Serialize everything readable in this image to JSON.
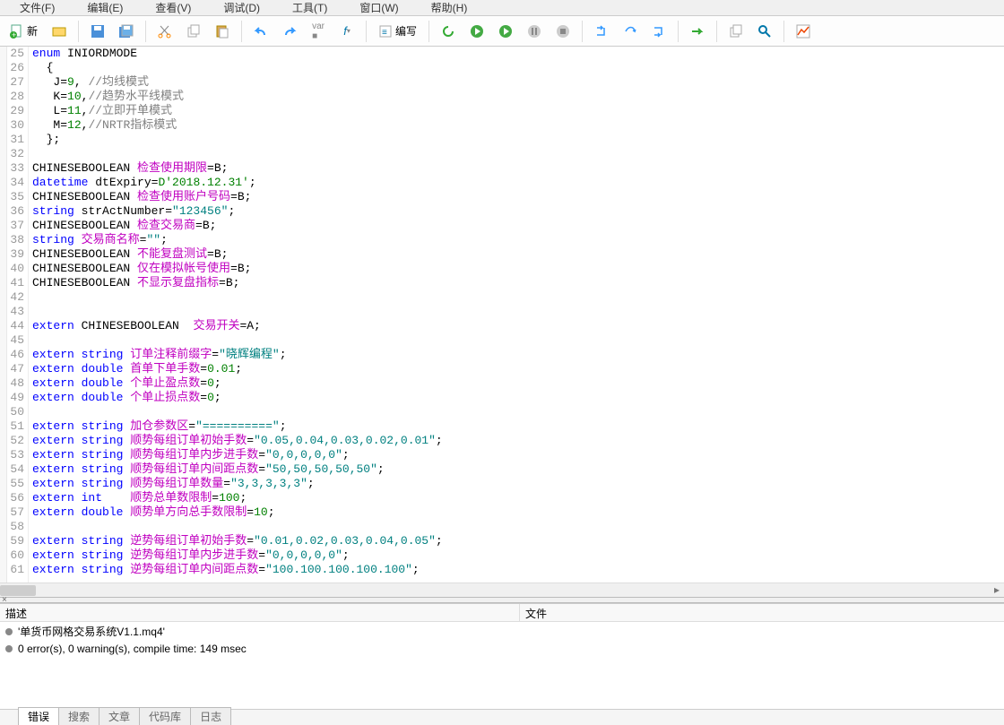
{
  "menubar": [
    {
      "label": "文件(F)"
    },
    {
      "label": "编辑(E)"
    },
    {
      "label": "查看(V)"
    },
    {
      "label": "调试(D)"
    },
    {
      "label": "工具(T)"
    },
    {
      "label": "窗口(W)"
    },
    {
      "label": "帮助(H)"
    }
  ],
  "toolbar": {
    "new_label": "新",
    "compile_label": "编写"
  },
  "code_lines": [
    {
      "n": 25,
      "tokens": [
        {
          "t": "enum",
          "c": "kw"
        },
        {
          "t": " INIORDMODE"
        }
      ]
    },
    {
      "n": 26,
      "tokens": [
        {
          "t": "  {"
        }
      ]
    },
    {
      "n": 27,
      "tokens": [
        {
          "t": "   J="
        },
        {
          "t": "9",
          "c": "num"
        },
        {
          "t": ", "
        },
        {
          "t": "//均线模式",
          "c": "com"
        }
      ]
    },
    {
      "n": 28,
      "tokens": [
        {
          "t": "   K="
        },
        {
          "t": "10",
          "c": "num"
        },
        {
          "t": ","
        },
        {
          "t": "//趋势水平线模式",
          "c": "com"
        }
      ]
    },
    {
      "n": 29,
      "tokens": [
        {
          "t": "   L="
        },
        {
          "t": "11",
          "c": "num"
        },
        {
          "t": ","
        },
        {
          "t": "//立即开单模式",
          "c": "com"
        }
      ]
    },
    {
      "n": 30,
      "tokens": [
        {
          "t": "   M="
        },
        {
          "t": "12",
          "c": "num"
        },
        {
          "t": ","
        },
        {
          "t": "//NRTR指标模式",
          "c": "com"
        }
      ]
    },
    {
      "n": 31,
      "tokens": [
        {
          "t": "  };"
        }
      ]
    },
    {
      "n": 32,
      "tokens": [
        {
          "t": ""
        }
      ]
    },
    {
      "n": 33,
      "tokens": [
        {
          "t": "CHINESEBOOLEAN "
        },
        {
          "t": "检查使用期限",
          "c": "ident"
        },
        {
          "t": "=B;"
        }
      ]
    },
    {
      "n": 34,
      "tokens": [
        {
          "t": "datetime",
          "c": "kw"
        },
        {
          "t": " dtExpiry="
        },
        {
          "t": "D'2018.12.31'",
          "c": "num"
        },
        {
          "t": ";"
        }
      ]
    },
    {
      "n": 35,
      "tokens": [
        {
          "t": "CHINESEBOOLEAN "
        },
        {
          "t": "检查使用账户号码",
          "c": "ident"
        },
        {
          "t": "=B;"
        }
      ]
    },
    {
      "n": 36,
      "tokens": [
        {
          "t": "string",
          "c": "kw"
        },
        {
          "t": " strActNumber="
        },
        {
          "t": "\"123456\"",
          "c": "str"
        },
        {
          "t": ";"
        }
      ]
    },
    {
      "n": 37,
      "tokens": [
        {
          "t": "CHINESEBOOLEAN "
        },
        {
          "t": "检查交易商",
          "c": "ident"
        },
        {
          "t": "=B;"
        }
      ]
    },
    {
      "n": 38,
      "tokens": [
        {
          "t": "string",
          "c": "kw"
        },
        {
          "t": " "
        },
        {
          "t": "交易商名称",
          "c": "ident"
        },
        {
          "t": "="
        },
        {
          "t": "\"\"",
          "c": "str"
        },
        {
          "t": ";"
        }
      ]
    },
    {
      "n": 39,
      "tokens": [
        {
          "t": "CHINESEBOOLEAN "
        },
        {
          "t": "不能复盘测试",
          "c": "ident"
        },
        {
          "t": "=B;"
        }
      ]
    },
    {
      "n": 40,
      "tokens": [
        {
          "t": "CHINESEBOOLEAN "
        },
        {
          "t": "仅在模拟帐号使用",
          "c": "ident"
        },
        {
          "t": "=B;"
        }
      ]
    },
    {
      "n": 41,
      "tokens": [
        {
          "t": "CHINESEBOOLEAN "
        },
        {
          "t": "不显示复盘指标",
          "c": "ident"
        },
        {
          "t": "=B;"
        }
      ]
    },
    {
      "n": 42,
      "tokens": [
        {
          "t": ""
        }
      ]
    },
    {
      "n": 43,
      "tokens": [
        {
          "t": ""
        }
      ]
    },
    {
      "n": 44,
      "tokens": [
        {
          "t": "extern",
          "c": "kw"
        },
        {
          "t": " CHINESEBOOLEAN  "
        },
        {
          "t": "交易开关",
          "c": "ident"
        },
        {
          "t": "=A;"
        }
      ]
    },
    {
      "n": 45,
      "tokens": [
        {
          "t": ""
        }
      ]
    },
    {
      "n": 46,
      "tokens": [
        {
          "t": "extern",
          "c": "kw"
        },
        {
          "t": " "
        },
        {
          "t": "string",
          "c": "kw"
        },
        {
          "t": " "
        },
        {
          "t": "订单注释前缀字",
          "c": "ident"
        },
        {
          "t": "="
        },
        {
          "t": "\"晓辉编程\"",
          "c": "str"
        },
        {
          "t": ";"
        }
      ]
    },
    {
      "n": 47,
      "tokens": [
        {
          "t": "extern",
          "c": "kw"
        },
        {
          "t": " "
        },
        {
          "t": "double",
          "c": "kw"
        },
        {
          "t": " "
        },
        {
          "t": "首单下单手数",
          "c": "ident"
        },
        {
          "t": "="
        },
        {
          "t": "0.01",
          "c": "num"
        },
        {
          "t": ";"
        }
      ]
    },
    {
      "n": 48,
      "tokens": [
        {
          "t": "extern",
          "c": "kw"
        },
        {
          "t": " "
        },
        {
          "t": "double",
          "c": "kw"
        },
        {
          "t": " "
        },
        {
          "t": "个单止盈点数",
          "c": "ident"
        },
        {
          "t": "="
        },
        {
          "t": "0",
          "c": "num"
        },
        {
          "t": ";"
        }
      ]
    },
    {
      "n": 49,
      "tokens": [
        {
          "t": "extern",
          "c": "kw"
        },
        {
          "t": " "
        },
        {
          "t": "double",
          "c": "kw"
        },
        {
          "t": " "
        },
        {
          "t": "个单止损点数",
          "c": "ident"
        },
        {
          "t": "="
        },
        {
          "t": "0",
          "c": "num"
        },
        {
          "t": ";"
        }
      ]
    },
    {
      "n": 50,
      "tokens": [
        {
          "t": ""
        }
      ]
    },
    {
      "n": 51,
      "tokens": [
        {
          "t": "extern",
          "c": "kw"
        },
        {
          "t": " "
        },
        {
          "t": "string",
          "c": "kw"
        },
        {
          "t": " "
        },
        {
          "t": "加仓参数区",
          "c": "ident"
        },
        {
          "t": "="
        },
        {
          "t": "\"==========\"",
          "c": "str"
        },
        {
          "t": ";"
        }
      ]
    },
    {
      "n": 52,
      "tokens": [
        {
          "t": "extern",
          "c": "kw"
        },
        {
          "t": " "
        },
        {
          "t": "string",
          "c": "kw"
        },
        {
          "t": " "
        },
        {
          "t": "顺势每组订单初始手数",
          "c": "ident"
        },
        {
          "t": "="
        },
        {
          "t": "\"0.05,0.04,0.03,0.02,0.01\"",
          "c": "str"
        },
        {
          "t": ";"
        }
      ]
    },
    {
      "n": 53,
      "tokens": [
        {
          "t": "extern",
          "c": "kw"
        },
        {
          "t": " "
        },
        {
          "t": "string",
          "c": "kw"
        },
        {
          "t": " "
        },
        {
          "t": "顺势每组订单内步进手数",
          "c": "ident"
        },
        {
          "t": "="
        },
        {
          "t": "\"0,0,0,0,0\"",
          "c": "str"
        },
        {
          "t": ";"
        }
      ]
    },
    {
      "n": 54,
      "tokens": [
        {
          "t": "extern",
          "c": "kw"
        },
        {
          "t": " "
        },
        {
          "t": "string",
          "c": "kw"
        },
        {
          "t": " "
        },
        {
          "t": "顺势每组订单内间距点数",
          "c": "ident"
        },
        {
          "t": "="
        },
        {
          "t": "\"50,50,50,50,50\"",
          "c": "str"
        },
        {
          "t": ";"
        }
      ]
    },
    {
      "n": 55,
      "tokens": [
        {
          "t": "extern",
          "c": "kw"
        },
        {
          "t": " "
        },
        {
          "t": "string",
          "c": "kw"
        },
        {
          "t": " "
        },
        {
          "t": "顺势每组订单数量",
          "c": "ident"
        },
        {
          "t": "="
        },
        {
          "t": "\"3,3,3,3,3\"",
          "c": "str"
        },
        {
          "t": ";"
        }
      ]
    },
    {
      "n": 56,
      "tokens": [
        {
          "t": "extern",
          "c": "kw"
        },
        {
          "t": " "
        },
        {
          "t": "int",
          "c": "kw"
        },
        {
          "t": "    "
        },
        {
          "t": "顺势总单数限制",
          "c": "ident"
        },
        {
          "t": "="
        },
        {
          "t": "100",
          "c": "num"
        },
        {
          "t": ";"
        }
      ]
    },
    {
      "n": 57,
      "tokens": [
        {
          "t": "extern",
          "c": "kw"
        },
        {
          "t": " "
        },
        {
          "t": "double",
          "c": "kw"
        },
        {
          "t": " "
        },
        {
          "t": "顺势单方向总手数限制",
          "c": "ident"
        },
        {
          "t": "="
        },
        {
          "t": "10",
          "c": "num"
        },
        {
          "t": ";"
        }
      ]
    },
    {
      "n": 58,
      "tokens": [
        {
          "t": ""
        }
      ]
    },
    {
      "n": 59,
      "tokens": [
        {
          "t": "extern",
          "c": "kw"
        },
        {
          "t": " "
        },
        {
          "t": "string",
          "c": "kw"
        },
        {
          "t": " "
        },
        {
          "t": "逆势每组订单初始手数",
          "c": "ident"
        },
        {
          "t": "="
        },
        {
          "t": "\"0.01,0.02,0.03,0.04,0.05\"",
          "c": "str"
        },
        {
          "t": ";"
        }
      ]
    },
    {
      "n": 60,
      "tokens": [
        {
          "t": "extern",
          "c": "kw"
        },
        {
          "t": " "
        },
        {
          "t": "string",
          "c": "kw"
        },
        {
          "t": " "
        },
        {
          "t": "逆势每组订单内步进手数",
          "c": "ident"
        },
        {
          "t": "="
        },
        {
          "t": "\"0,0,0,0,0\"",
          "c": "str"
        },
        {
          "t": ";"
        }
      ]
    },
    {
      "n": 61,
      "tokens": [
        {
          "t": "extern",
          "c": "kw"
        },
        {
          "t": " "
        },
        {
          "t": "string",
          "c": "kw"
        },
        {
          "t": " "
        },
        {
          "t": "逆势每组订单内间距点数",
          "c": "ident"
        },
        {
          "t": "="
        },
        {
          "t": "\"100.100.100.100.100\"",
          "c": "str"
        },
        {
          "t": ";"
        }
      ]
    }
  ],
  "bottom": {
    "col_desc": "描述",
    "col_file": "文件",
    "rows": [
      "'单货币网格交易系统V1.1.mq4'",
      "0 error(s), 0 warning(s), compile time: 149 msec"
    ]
  },
  "tabs": [
    {
      "label": "错误",
      "active": true
    },
    {
      "label": "搜索",
      "active": false
    },
    {
      "label": "文章",
      "active": false
    },
    {
      "label": "代码库",
      "active": false
    },
    {
      "label": "日志",
      "active": false
    }
  ]
}
